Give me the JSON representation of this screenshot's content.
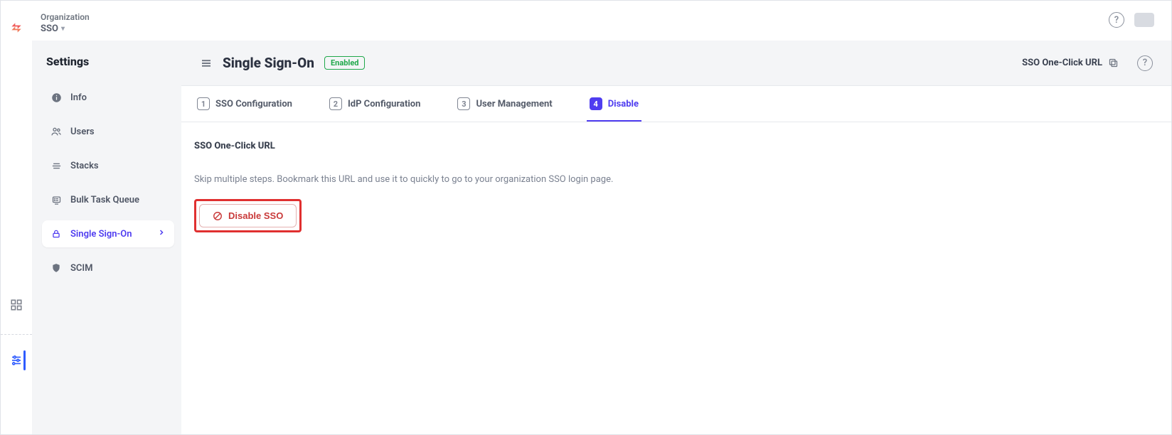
{
  "breadcrumb": {
    "top": "Organization",
    "main": "SSO"
  },
  "sidebar": {
    "title": "Settings",
    "items": [
      {
        "label": "Info"
      },
      {
        "label": "Users"
      },
      {
        "label": "Stacks"
      },
      {
        "label": "Bulk Task Queue"
      },
      {
        "label": "Single Sign-On"
      },
      {
        "label": "SCIM"
      }
    ]
  },
  "page": {
    "title": "Single Sign-On",
    "status_badge": "Enabled",
    "one_click_label": "SSO One-Click URL"
  },
  "tabs": [
    {
      "num": "1",
      "label": "SSO Configuration"
    },
    {
      "num": "2",
      "label": "IdP Configuration"
    },
    {
      "num": "3",
      "label": "User Management"
    },
    {
      "num": "4",
      "label": "Disable"
    }
  ],
  "body": {
    "section_title": "SSO One-Click URL",
    "helper_text": "Skip multiple steps. Bookmark this URL and use it to quickly to go to your organization SSO login page.",
    "disable_button": "Disable SSO"
  }
}
